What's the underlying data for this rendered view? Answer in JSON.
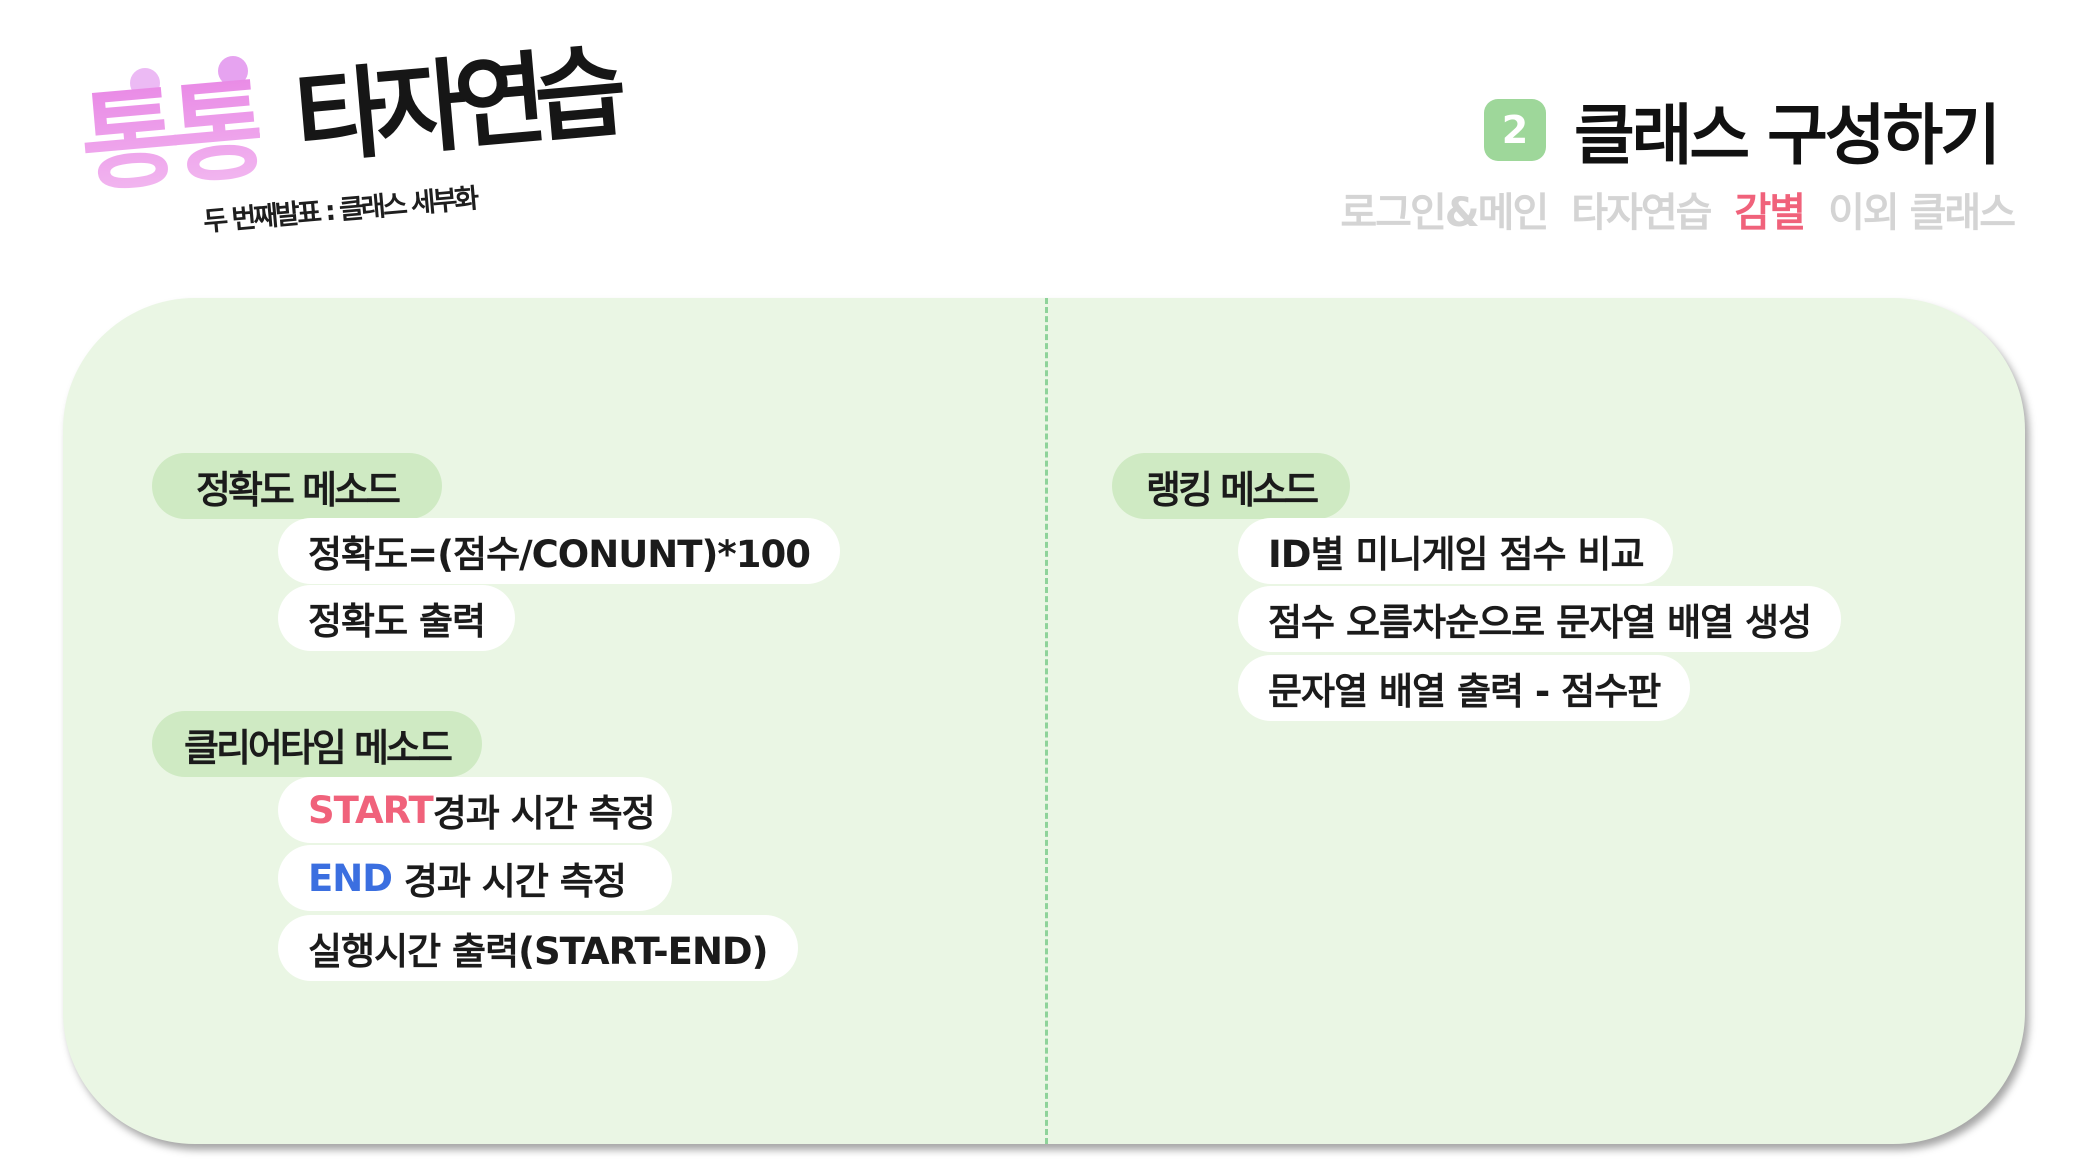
{
  "logo": {
    "main_pink": "통통",
    "main_black": "타자연습",
    "subtitle": "두 번째발표 : 클래스 세부화"
  },
  "header": {
    "section_number": "2",
    "section_title": "클래스 구성하기",
    "breadcrumbs": [
      "로그인&메인",
      "타자연습",
      "감별",
      "이외 클래스"
    ],
    "active_breadcrumb": "감별"
  },
  "left": {
    "accuracy": {
      "title": "정확도 메소드",
      "items": [
        "정확도=(점수/CONUNT)*100",
        "정확도 출력"
      ]
    },
    "cleartime": {
      "title": "클리어타임 메소드",
      "items": [
        {
          "keyword": "START",
          "rest": "경과 시간 측정"
        },
        {
          "keyword": "END",
          "rest": " 경과 시간 측정"
        },
        {
          "keyword": "",
          "rest": "실행시간 출력(START-END)"
        }
      ]
    }
  },
  "right": {
    "ranking": {
      "title": "랭킹 메소드",
      "items": [
        "ID별 미니게임 점수 비교",
        "점수 오름차순으로 문자열 배열 생성",
        "문자열 배열 출력 - 점수판"
      ]
    }
  },
  "colors": {
    "accent_green": "#9ed79a",
    "panel_bg": "#eaf6e4",
    "keyword_red": "#f0627b",
    "keyword_blue": "#3b6fe0",
    "logo_pink": "#ec97ea"
  }
}
